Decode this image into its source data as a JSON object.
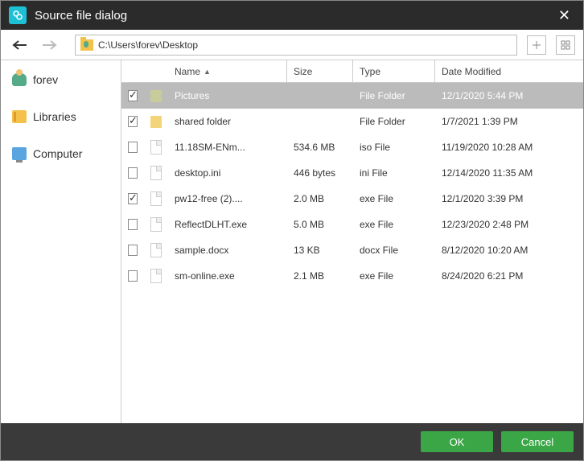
{
  "window": {
    "title": "Source file dialog"
  },
  "nav": {
    "path": "C:\\Users\\forev\\Desktop"
  },
  "sidebar": {
    "items": [
      {
        "label": "forev",
        "icon": "user"
      },
      {
        "label": "Libraries",
        "icon": "libraries"
      },
      {
        "label": "Computer",
        "icon": "computer"
      }
    ]
  },
  "columns": {
    "name": "Name",
    "size": "Size",
    "type": "Type",
    "date": "Date Modified"
  },
  "files": [
    {
      "checked": true,
      "selected": true,
      "icon": "folder",
      "name": "Pictures",
      "size": "",
      "type": "File Folder",
      "date": "12/1/2020 5:44 PM"
    },
    {
      "checked": true,
      "selected": false,
      "icon": "folder",
      "name": "shared folder",
      "size": "",
      "type": "File Folder",
      "date": "1/7/2021 1:39 PM"
    },
    {
      "checked": false,
      "selected": false,
      "icon": "file",
      "name": "11.18SM-ENm...",
      "size": "534.6 MB",
      "type": "iso File",
      "date": "11/19/2020 10:28 AM"
    },
    {
      "checked": false,
      "selected": false,
      "icon": "file",
      "name": "desktop.ini",
      "size": "446 bytes",
      "type": "ini File",
      "date": "12/14/2020 11:35 AM"
    },
    {
      "checked": true,
      "selected": false,
      "icon": "file",
      "name": "pw12-free (2)....",
      "size": "2.0 MB",
      "type": "exe File",
      "date": "12/1/2020 3:39 PM"
    },
    {
      "checked": false,
      "selected": false,
      "icon": "file",
      "name": "ReflectDLHT.exe",
      "size": "5.0 MB",
      "type": "exe File",
      "date": "12/23/2020 2:48 PM"
    },
    {
      "checked": false,
      "selected": false,
      "icon": "file",
      "name": "sample.docx",
      "size": "13 KB",
      "type": "docx File",
      "date": "8/12/2020 10:20 AM"
    },
    {
      "checked": false,
      "selected": false,
      "icon": "file",
      "name": "sm-online.exe",
      "size": "2.1 MB",
      "type": "exe File",
      "date": "8/24/2020 6:21 PM"
    }
  ],
  "buttons": {
    "ok": "OK",
    "cancel": "Cancel"
  }
}
